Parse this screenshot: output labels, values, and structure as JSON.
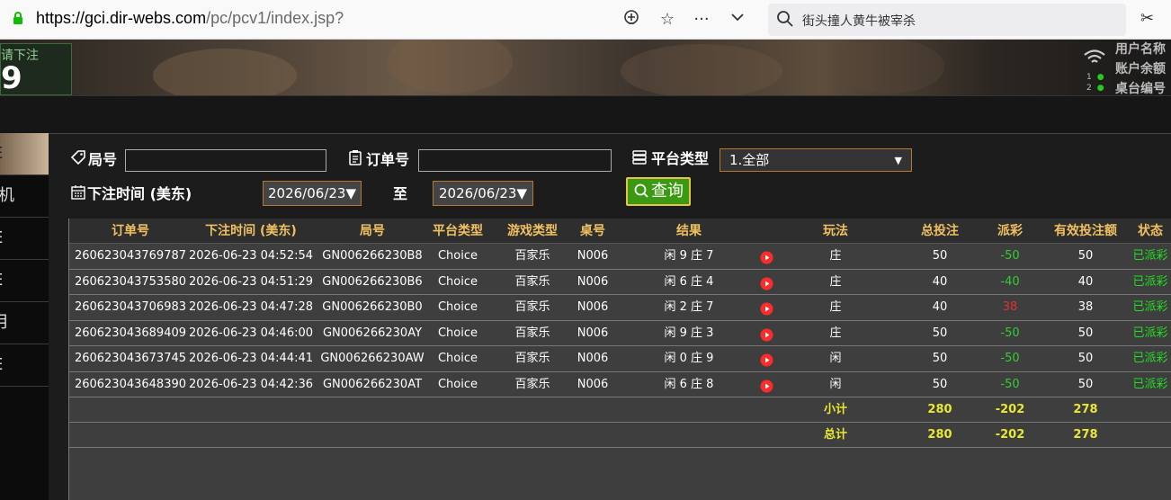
{
  "browser": {
    "url_domain": "https://gci.dir-webs.com",
    "url_path": "/pc/pcv1/index.jsp?",
    "search_text": "街头撞人黄牛被宰杀"
  },
  "header": {
    "bet_label": "请下注",
    "bet_number": "9",
    "right_labels": [
      "用户名称",
      "账户余额",
      "桌台编号"
    ],
    "dot_labels": [
      "1",
      "2"
    ]
  },
  "side_menu": {
    "items": [
      "E",
      "机",
      "E",
      "E",
      "月",
      "E"
    ]
  },
  "filters": {
    "round_label": "局号",
    "round_value": "",
    "order_label": "订单号",
    "order_value": "",
    "platform_label": "平台类型",
    "platform_selected": "1.全部",
    "time_label": "下注时间 (美东)",
    "date_from": "2026/06/23▼",
    "to_label": "至",
    "date_to": "2026/06/23▼",
    "query_label": "查询"
  },
  "table": {
    "headers": [
      "订单号",
      "下注时间 (美东)",
      "局号",
      "平台类型",
      "游戏类型",
      "桌号",
      "结果",
      "",
      "玩法",
      "总投注",
      "派彩",
      "有效投注额",
      "状态"
    ],
    "rows": [
      {
        "order": "260623043769787",
        "time": "2026-06-23 04:52:54",
        "round": "GN006266230B8",
        "platform": "Choice",
        "game": "百家乐",
        "table": "N006",
        "result": "闲 9 庄 7",
        "play": "庄",
        "bet": "50",
        "payout": "-50",
        "payout_color": "green",
        "valid": "50",
        "status": "已派彩"
      },
      {
        "order": "260623043753580",
        "time": "2026-06-23 04:51:29",
        "round": "GN006266230B6",
        "platform": "Choice",
        "game": "百家乐",
        "table": "N006",
        "result": "闲 6 庄 4",
        "play": "庄",
        "bet": "40",
        "payout": "-40",
        "payout_color": "green",
        "valid": "40",
        "status": "已派彩"
      },
      {
        "order": "260623043706983",
        "time": "2026-06-23 04:47:28",
        "round": "GN006266230B0",
        "platform": "Choice",
        "game": "百家乐",
        "table": "N006",
        "result": "闲 2 庄 7",
        "play": "庄",
        "bet": "40",
        "payout": "38",
        "payout_color": "red",
        "valid": "38",
        "status": "已派彩"
      },
      {
        "order": "260623043689409",
        "time": "2026-06-23 04:46:00",
        "round": "GN006266230AY",
        "platform": "Choice",
        "game": "百家乐",
        "table": "N006",
        "result": "闲 9 庄 3",
        "play": "庄",
        "bet": "50",
        "payout": "-50",
        "payout_color": "green",
        "valid": "50",
        "status": "已派彩"
      },
      {
        "order": "260623043673745",
        "time": "2026-06-23 04:44:41",
        "round": "GN006266230AW",
        "platform": "Choice",
        "game": "百家乐",
        "table": "N006",
        "result": "闲 0 庄 9",
        "play": "闲",
        "bet": "50",
        "payout": "-50",
        "payout_color": "green",
        "valid": "50",
        "status": "已派彩"
      },
      {
        "order": "260623043648390",
        "time": "2026-06-23 04:42:36",
        "round": "GN006266230AT",
        "platform": "Choice",
        "game": "百家乐",
        "table": "N006",
        "result": "闲 6 庄 8",
        "play": "闲",
        "bet": "50",
        "payout": "-50",
        "payout_color": "green",
        "valid": "50",
        "status": "已派彩"
      }
    ],
    "subtotal": {
      "label": "小计",
      "bet": "280",
      "payout": "-202",
      "valid": "278"
    },
    "total": {
      "label": "总计",
      "bet": "280",
      "payout": "-202",
      "valid": "278"
    }
  },
  "colors": {
    "accent_gold": "#f0c060",
    "status_green": "#22dd22",
    "sum_yellow": "#e8e830",
    "query_green": "#3a9a12"
  }
}
